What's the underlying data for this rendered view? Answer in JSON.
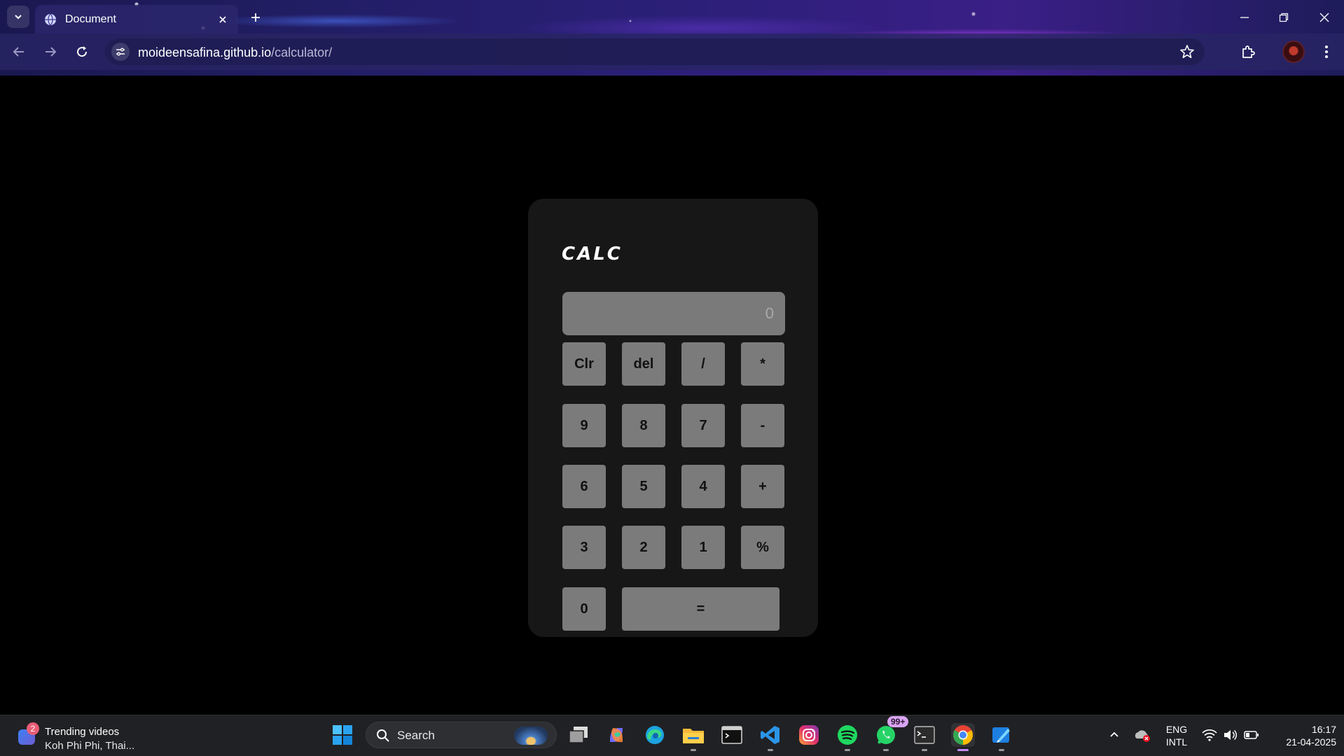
{
  "browser": {
    "tab_title": "Document",
    "url_host": "moideensafina.github.io",
    "url_path": "/calculator/"
  },
  "calculator": {
    "title": "CALC",
    "display_value": "0",
    "keys": {
      "clr": "Clr",
      "del": "del",
      "divide": "/",
      "multiply": "*",
      "nine": "9",
      "eight": "8",
      "seven": "7",
      "minus": "-",
      "six": "6",
      "five": "5",
      "four": "4",
      "plus": "+",
      "three": "3",
      "two": "2",
      "one": "1",
      "percent": "%",
      "zero": "0",
      "equals": "="
    },
    "colors": {
      "card": "#171717",
      "key": "#7b7b7b",
      "display": "#7a7a7a"
    }
  },
  "taskbar": {
    "widget_title": "Trending videos",
    "widget_subtitle": "Koh Phi Phi, Thai...",
    "widget_badge": "2",
    "search_label": "Search",
    "whatsapp_badge": "99+",
    "language_line1": "ENG",
    "language_line2": "INTL",
    "time": "16:17",
    "date": "21-04-2025",
    "icons": [
      "start-icon",
      "search-icon",
      "task-view-icon",
      "copilot-icon",
      "edge-icon",
      "file-explorer-icon",
      "terminal-icon",
      "vscode-icon",
      "instagram-icon",
      "spotify-icon",
      "whatsapp-icon",
      "git-bash-icon",
      "chrome-icon",
      "paint-icon"
    ]
  }
}
